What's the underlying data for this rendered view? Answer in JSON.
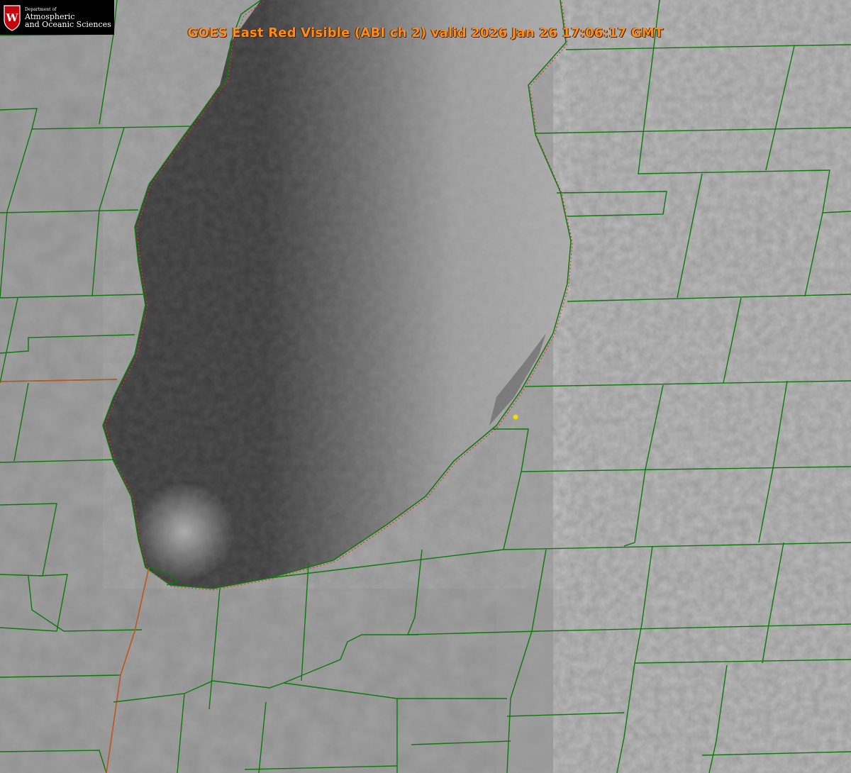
{
  "title": "GOES East Red Visible (ABI ch 2) valid 2026 Jan 26 17:06:17 GMT",
  "logo": {
    "line1": "Department of",
    "line2": "Atmospheric",
    "line3": "and Oceanic Sciences",
    "crest_letter": "W"
  },
  "colors": {
    "county_lines": "#0a7a0a",
    "state_line": "#c0551b",
    "shoreline_dotted": "#e23030",
    "title_text": "#ff8c1a",
    "marker": "#e8e000"
  }
}
